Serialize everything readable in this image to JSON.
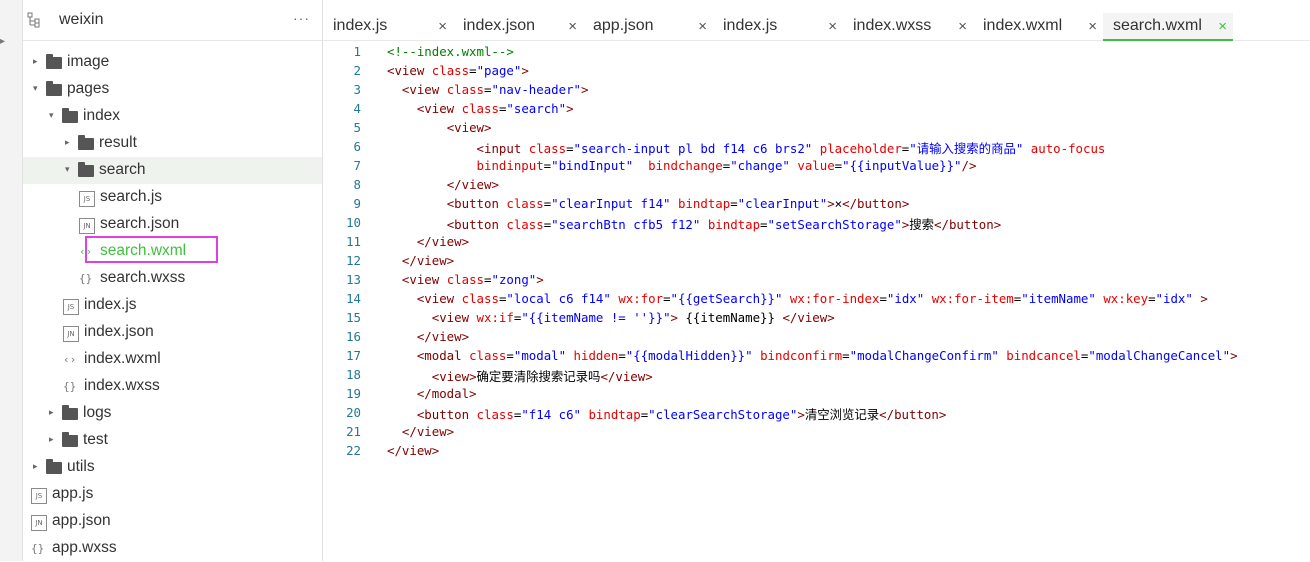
{
  "sidebar": {
    "title": "weixin",
    "more": "···",
    "items": [
      {
        "label": "image",
        "depth": 0,
        "kind": "folder",
        "twisty": "closed"
      },
      {
        "label": "pages",
        "depth": 0,
        "kind": "folder",
        "twisty": "open"
      },
      {
        "label": "index",
        "depth": 1,
        "kind": "folder",
        "twisty": "open"
      },
      {
        "label": "result",
        "depth": 2,
        "kind": "folder",
        "twisty": "closed"
      },
      {
        "label": "search",
        "depth": 2,
        "kind": "folder",
        "twisty": "open",
        "selected": true
      },
      {
        "label": "search.js",
        "depth": 3,
        "kind": "js"
      },
      {
        "label": "search.json",
        "depth": 3,
        "kind": "json"
      },
      {
        "label": "search.wxml",
        "depth": 3,
        "kind": "wxml",
        "active": true
      },
      {
        "label": "search.wxss",
        "depth": 3,
        "kind": "wxss"
      },
      {
        "label": "index.js",
        "depth": 2,
        "kind": "js"
      },
      {
        "label": "index.json",
        "depth": 2,
        "kind": "json"
      },
      {
        "label": "index.wxml",
        "depth": 2,
        "kind": "wxml"
      },
      {
        "label": "index.wxss",
        "depth": 2,
        "kind": "wxss"
      },
      {
        "label": "logs",
        "depth": 1,
        "kind": "folder",
        "twisty": "closed"
      },
      {
        "label": "test",
        "depth": 1,
        "kind": "folder",
        "twisty": "closed"
      },
      {
        "label": "utils",
        "depth": 0,
        "kind": "folder",
        "twisty": "closed"
      },
      {
        "label": "app.js",
        "depth": 0,
        "kind": "js"
      },
      {
        "label": "app.json",
        "depth": 0,
        "kind": "json"
      },
      {
        "label": "app.wxss",
        "depth": 0,
        "kind": "wxss"
      }
    ]
  },
  "tabs": [
    {
      "label": "index.js"
    },
    {
      "label": "index.json"
    },
    {
      "label": "app.json"
    },
    {
      "label": "index.js"
    },
    {
      "label": "index.wxss"
    },
    {
      "label": "index.wxml"
    },
    {
      "label": "search.wxml",
      "active": true
    }
  ],
  "tab_close": "×",
  "colors": {
    "accent": "#3fbf3f",
    "highlight_box": "#e040e0",
    "tag": "#800000",
    "attr": "#e50000",
    "value": "#0000ff",
    "comment": "#008000",
    "line_number": "#237893"
  },
  "code_lines": [
    [
      [
        "c",
        "<!--index.wxml-->"
      ]
    ],
    [
      [
        "t",
        "<view"
      ],
      [
        "p",
        " "
      ],
      [
        "a",
        "class"
      ],
      [
        "p",
        "="
      ],
      [
        "v",
        "\"page\""
      ],
      [
        "t",
        ">"
      ]
    ],
    [
      [
        "p",
        "  "
      ],
      [
        "t",
        "<view"
      ],
      [
        "p",
        " "
      ],
      [
        "a",
        "class"
      ],
      [
        "p",
        "="
      ],
      [
        "v",
        "\"nav-header\""
      ],
      [
        "t",
        ">"
      ]
    ],
    [
      [
        "p",
        "    "
      ],
      [
        "t",
        "<view"
      ],
      [
        "p",
        " "
      ],
      [
        "a",
        "class"
      ],
      [
        "p",
        "="
      ],
      [
        "v",
        "\"search\""
      ],
      [
        "t",
        ">"
      ]
    ],
    [
      [
        "p",
        "        "
      ],
      [
        "t",
        "<view>"
      ]
    ],
    [
      [
        "p",
        "            "
      ],
      [
        "t",
        "<input"
      ],
      [
        "p",
        " "
      ],
      [
        "a",
        "class"
      ],
      [
        "p",
        "="
      ],
      [
        "v",
        "\"search-input pl bd f14 c6 brs2\""
      ],
      [
        "p",
        " "
      ],
      [
        "a",
        "placeholder"
      ],
      [
        "p",
        "="
      ],
      [
        "v",
        "\"请输入搜索的商品\""
      ],
      [
        "p",
        " "
      ],
      [
        "a",
        "auto-focus"
      ]
    ],
    [
      [
        "p",
        "            "
      ],
      [
        "a",
        "bindinput"
      ],
      [
        "p",
        "="
      ],
      [
        "v",
        "\"bindInput\""
      ],
      [
        "p",
        "  "
      ],
      [
        "a",
        "bindchange"
      ],
      [
        "p",
        "="
      ],
      [
        "v",
        "\"change\""
      ],
      [
        "p",
        " "
      ],
      [
        "a",
        "value"
      ],
      [
        "p",
        "="
      ],
      [
        "v",
        "\"{{inputValue}}\""
      ],
      [
        "t",
        "/>"
      ]
    ],
    [
      [
        "p",
        "        "
      ],
      [
        "t",
        "</view>"
      ]
    ],
    [
      [
        "p",
        "        "
      ],
      [
        "t",
        "<button"
      ],
      [
        "p",
        " "
      ],
      [
        "a",
        "class"
      ],
      [
        "p",
        "="
      ],
      [
        "v",
        "\"clearInput f14\""
      ],
      [
        "p",
        " "
      ],
      [
        "a",
        "bindtap"
      ],
      [
        "p",
        "="
      ],
      [
        "v",
        "\"clearInput\""
      ],
      [
        "t",
        ">"
      ],
      [
        "p",
        "×"
      ],
      [
        "t",
        "</button>"
      ]
    ],
    [
      [
        "p",
        "        "
      ],
      [
        "t",
        "<button"
      ],
      [
        "p",
        " "
      ],
      [
        "a",
        "class"
      ],
      [
        "p",
        "="
      ],
      [
        "v",
        "\"searchBtn cfb5 f12\""
      ],
      [
        "p",
        " "
      ],
      [
        "a",
        "bindtap"
      ],
      [
        "p",
        "="
      ],
      [
        "v",
        "\"setSearchStorage\""
      ],
      [
        "t",
        ">"
      ],
      [
        "p",
        "搜索"
      ],
      [
        "t",
        "</button>"
      ]
    ],
    [
      [
        "p",
        "    "
      ],
      [
        "t",
        "</view>"
      ]
    ],
    [
      [
        "p",
        "  "
      ],
      [
        "t",
        "</view>"
      ]
    ],
    [
      [
        "p",
        "  "
      ],
      [
        "t",
        "<view"
      ],
      [
        "p",
        " "
      ],
      [
        "a",
        "class"
      ],
      [
        "p",
        "="
      ],
      [
        "v",
        "\"zong\""
      ],
      [
        "t",
        ">"
      ]
    ],
    [
      [
        "p",
        "    "
      ],
      [
        "t",
        "<view"
      ],
      [
        "p",
        " "
      ],
      [
        "a",
        "class"
      ],
      [
        "p",
        "="
      ],
      [
        "v",
        "\"local c6 f14\""
      ],
      [
        "p",
        " "
      ],
      [
        "a",
        "wx:for"
      ],
      [
        "p",
        "="
      ],
      [
        "v",
        "\"{{getSearch}}\""
      ],
      [
        "p",
        " "
      ],
      [
        "a",
        "wx:for-index"
      ],
      [
        "p",
        "="
      ],
      [
        "v",
        "\"idx\""
      ],
      [
        "p",
        " "
      ],
      [
        "a",
        "wx:for-item"
      ],
      [
        "p",
        "="
      ],
      [
        "v",
        "\"itemName\""
      ],
      [
        "p",
        " "
      ],
      [
        "a",
        "wx:key"
      ],
      [
        "p",
        "="
      ],
      [
        "v",
        "\"idx\""
      ],
      [
        "p",
        " "
      ],
      [
        "t",
        ">"
      ]
    ],
    [
      [
        "p",
        "      "
      ],
      [
        "t",
        "<view"
      ],
      [
        "p",
        " "
      ],
      [
        "a",
        "wx:if"
      ],
      [
        "p",
        "="
      ],
      [
        "v",
        "\"{{itemName != ''}}\""
      ],
      [
        "t",
        ">"
      ],
      [
        "p",
        " {{itemName}} "
      ],
      [
        "t",
        "</view>"
      ]
    ],
    [
      [
        "p",
        "    "
      ],
      [
        "t",
        "</view>"
      ]
    ],
    [
      [
        "p",
        "    "
      ],
      [
        "t",
        "<modal"
      ],
      [
        "p",
        " "
      ],
      [
        "a",
        "class"
      ],
      [
        "p",
        "="
      ],
      [
        "v",
        "\"modal\""
      ],
      [
        "p",
        " "
      ],
      [
        "a",
        "hidden"
      ],
      [
        "p",
        "="
      ],
      [
        "v",
        "\"{{modalHidden}}\""
      ],
      [
        "p",
        " "
      ],
      [
        "a",
        "bindconfirm"
      ],
      [
        "p",
        "="
      ],
      [
        "v",
        "\"modalChangeConfirm\""
      ],
      [
        "p",
        " "
      ],
      [
        "a",
        "bindcancel"
      ],
      [
        "p",
        "="
      ],
      [
        "v",
        "\"modalChangeCancel\""
      ],
      [
        "t",
        ">"
      ]
    ],
    [
      [
        "p",
        "      "
      ],
      [
        "t",
        "<view>"
      ],
      [
        "p",
        "确定要清除搜索记录吗"
      ],
      [
        "t",
        "</view>"
      ]
    ],
    [
      [
        "p",
        "    "
      ],
      [
        "t",
        "</modal>"
      ]
    ],
    [
      [
        "p",
        "    "
      ],
      [
        "t",
        "<button"
      ],
      [
        "p",
        " "
      ],
      [
        "a",
        "class"
      ],
      [
        "p",
        "="
      ],
      [
        "v",
        "\"f14 c6\""
      ],
      [
        "p",
        " "
      ],
      [
        "a",
        "bindtap"
      ],
      [
        "p",
        "="
      ],
      [
        "v",
        "\"clearSearchStorage\""
      ],
      [
        "t",
        ">"
      ],
      [
        "p",
        "清空浏览记录"
      ],
      [
        "t",
        "</button>"
      ]
    ],
    [
      [
        "p",
        "  "
      ],
      [
        "t",
        "</view>"
      ]
    ],
    [
      [
        "t",
        "</view>"
      ]
    ]
  ]
}
